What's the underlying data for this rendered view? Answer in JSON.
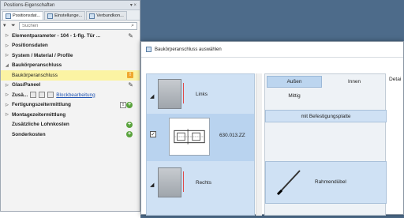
{
  "panel": {
    "title": "Positions-Eigenschaften",
    "title_controls": "▾ ×",
    "tabs": [
      {
        "label": "Positionsdat..."
      },
      {
        "label": "Einstellunge..."
      },
      {
        "label": "Verbundkon..."
      }
    ],
    "search_placeholder": "Suchen",
    "rows": [
      {
        "label": "Elementparameter - 104 - 1-flg. Tür ..."
      },
      {
        "label": "Positionsdaten"
      },
      {
        "label": "System / Material / Profile"
      },
      {
        "label": "Baukörperanschluss"
      },
      {
        "label": "Baukörperanschluss"
      },
      {
        "label": "Glas/Paneel"
      },
      {
        "label": "Zusä...",
        "link": "Blockbearbeitung"
      },
      {
        "label": "Fertigungszeitermittlung"
      },
      {
        "label": "Montagezeitermittlung"
      },
      {
        "label": "Zusätzliche Lohnkosten"
      },
      {
        "label": "Sonderkosten"
      }
    ],
    "warn_symbol": "!",
    "plus_symbol": "+"
  },
  "dialog": {
    "title": "Baukörperanschluss auswählen",
    "items": [
      {
        "label": "Links"
      },
      {
        "label": "630.013.ZZ"
      },
      {
        "label": "Rechts"
      }
    ],
    "check_mark": "✓",
    "position_options": [
      "Außen",
      "Innen",
      "Mittig"
    ],
    "plate_button": "mit Befestigungsplatte",
    "profile_button": "Rahmendübel",
    "detail_header": "Detai"
  }
}
